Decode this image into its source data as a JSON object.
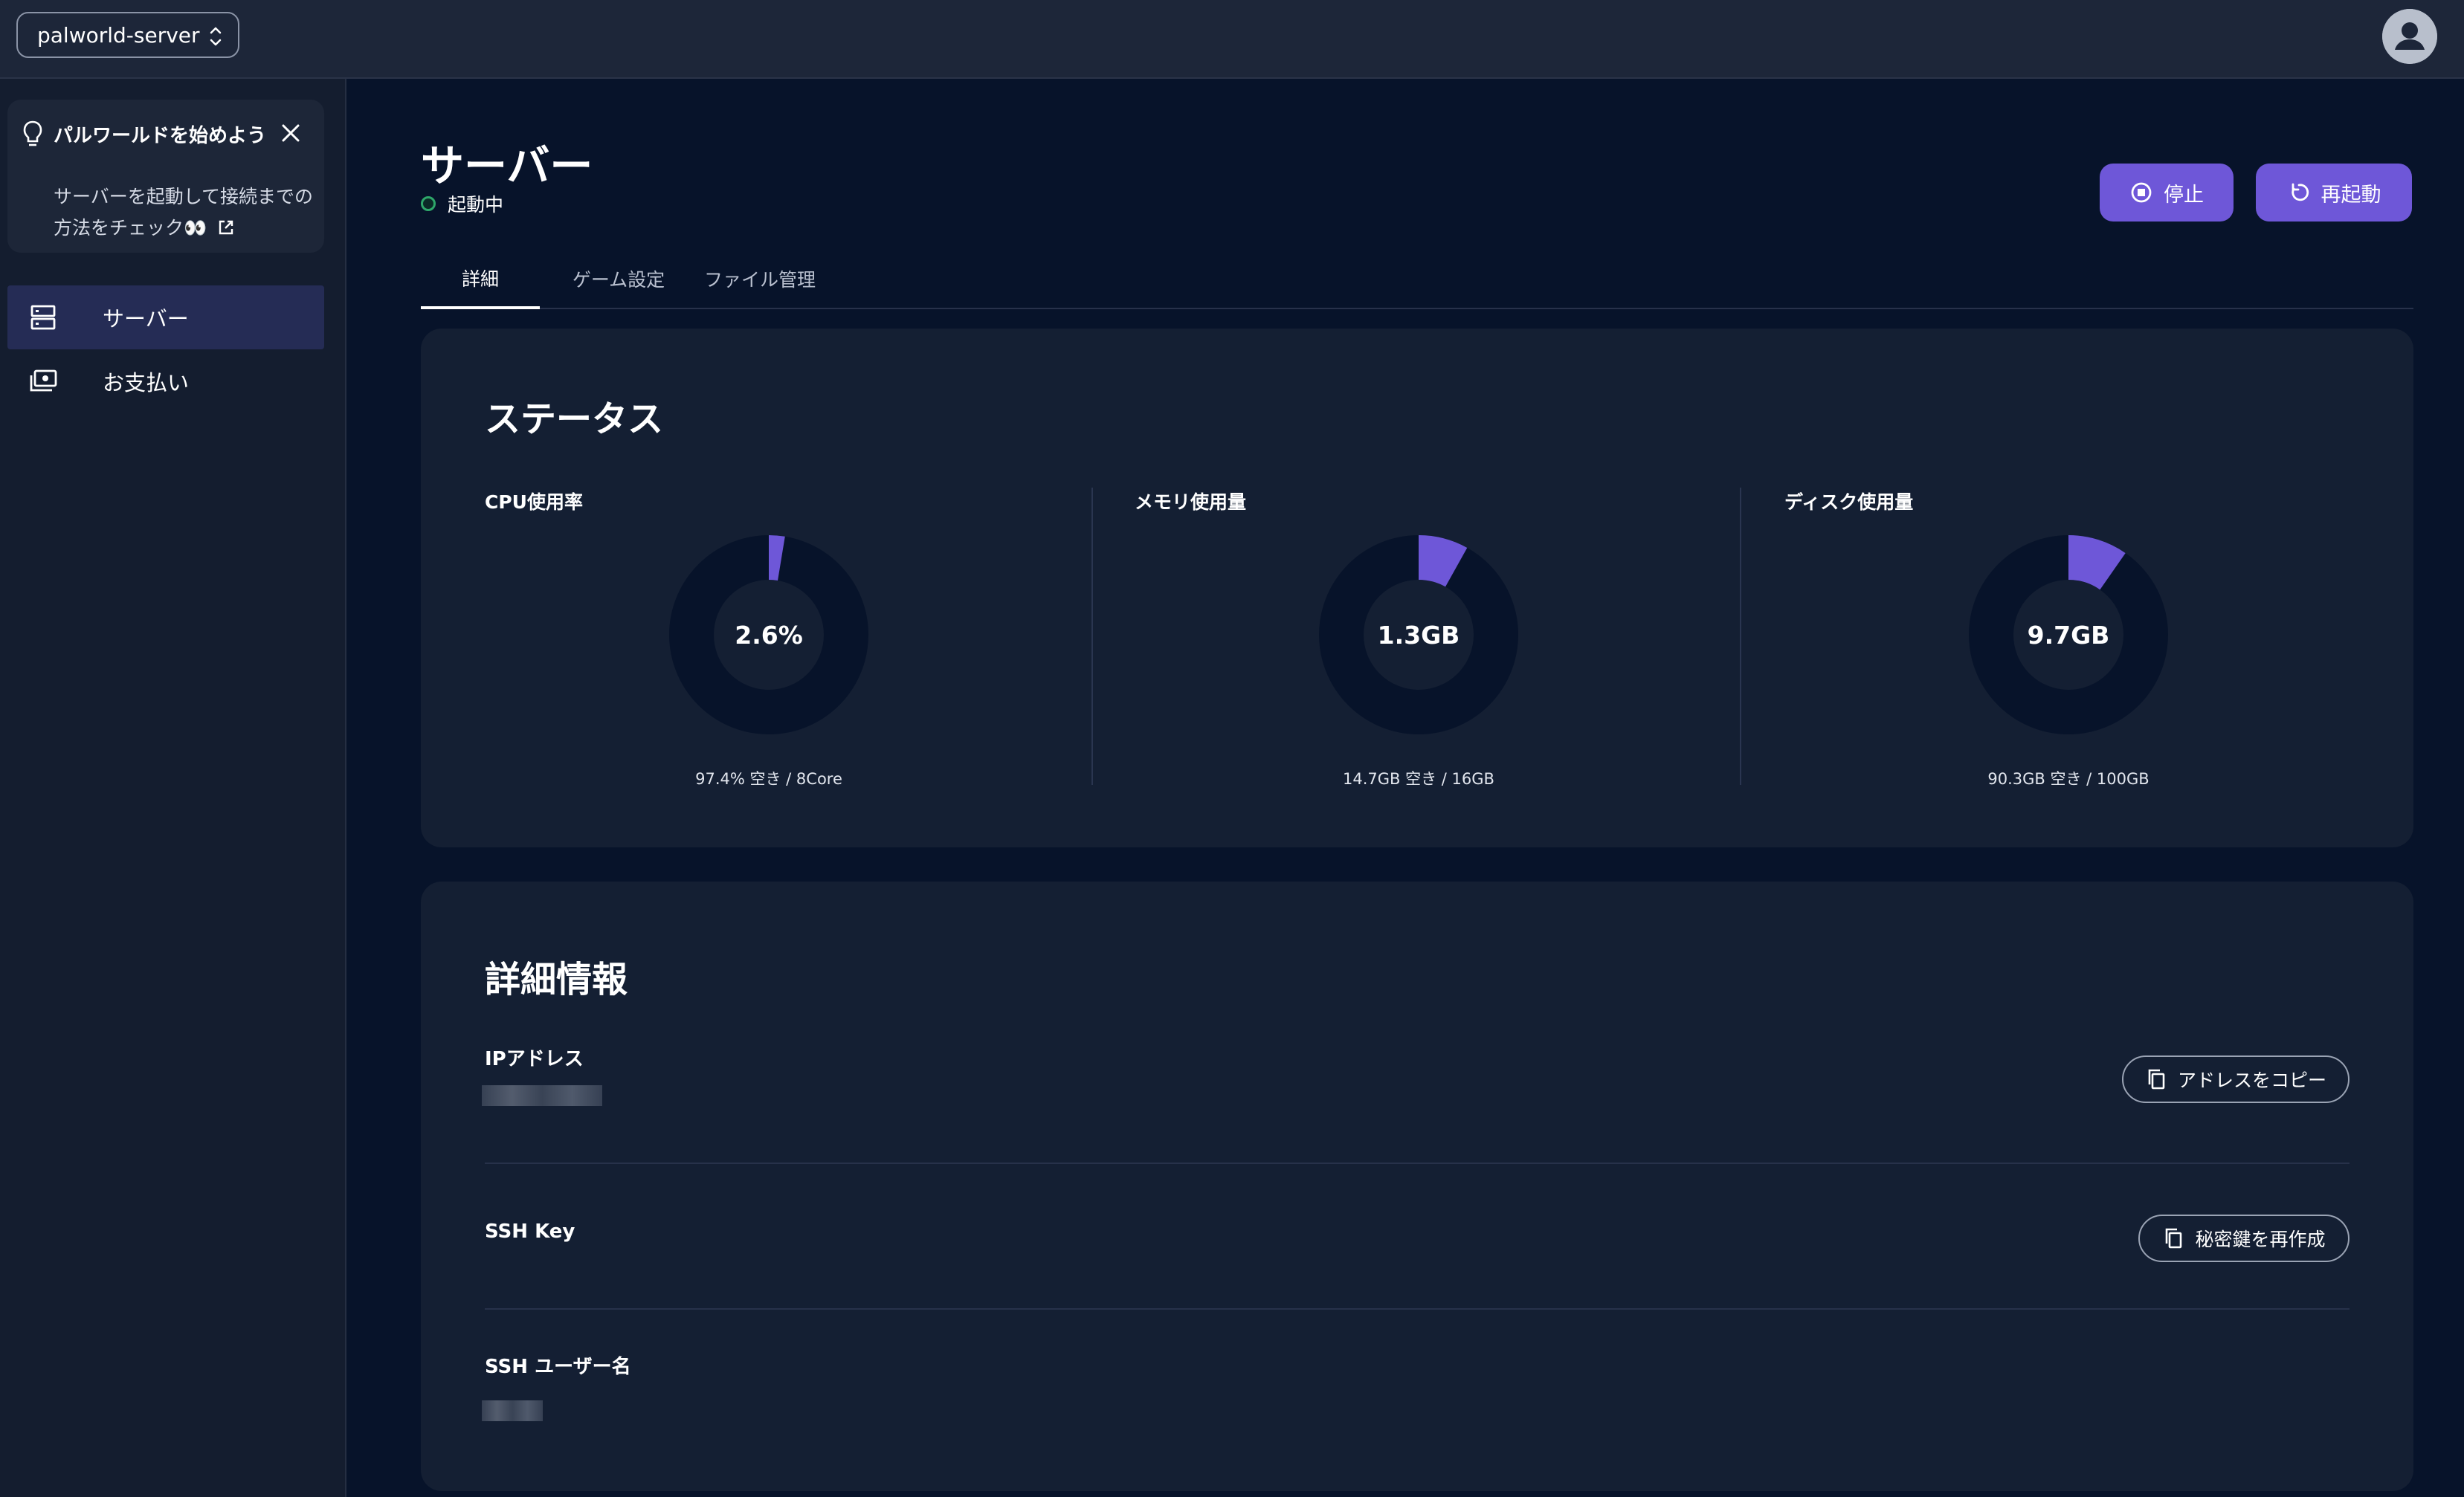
{
  "topbar": {
    "server_name": "palworld-server",
    "server_chevron_icon": "unfold-icon",
    "avatar_icon": "account-circle-icon"
  },
  "sidebar": {
    "tip": {
      "title": "パルワールドを始めよう",
      "body": "サーバーを起動して接続までの方法をチェック👀",
      "icons": [
        "lightbulb-icon",
        "close-icon",
        "external-link-icon"
      ]
    },
    "items": [
      {
        "label": "サーバー",
        "icon": "server-icon",
        "active": true
      },
      {
        "label": "お支払い",
        "icon": "payment-icon",
        "active": false
      }
    ]
  },
  "header": {
    "title": "サーバー",
    "status": "起動中",
    "status_color": "#2ea76a",
    "stop_label": "停止",
    "restart_label": "再起動",
    "accent": "#6e57d8"
  },
  "tabs": [
    {
      "label": "詳細",
      "active": true
    },
    {
      "label": "ゲーム設定",
      "active": false
    },
    {
      "label": "ファイル管理",
      "active": false
    }
  ],
  "status_card": {
    "title": "ステータス",
    "metrics": [
      {
        "label": "CPU使用率",
        "value": "2.6%",
        "fraction": 0.026,
        "sub": "97.4% 空き / 8Core"
      },
      {
        "label": "メモリ使用量",
        "value": "1.3GB",
        "fraction": 0.081,
        "sub": "14.7GB 空き / 16GB"
      },
      {
        "label": "ディスク使用量",
        "value": "9.7GB",
        "fraction": 0.097,
        "sub": "90.3GB 空き / 100GB"
      }
    ]
  },
  "details_card": {
    "title": "詳細情報",
    "ip_label": "IPアドレス",
    "copy_address_label": "アドレスをコピー",
    "ssh_key_label": "SSH Key",
    "regenerate_key_label": "秘密鍵を再作成",
    "ssh_user_label": "SSH ユーザー名"
  }
}
